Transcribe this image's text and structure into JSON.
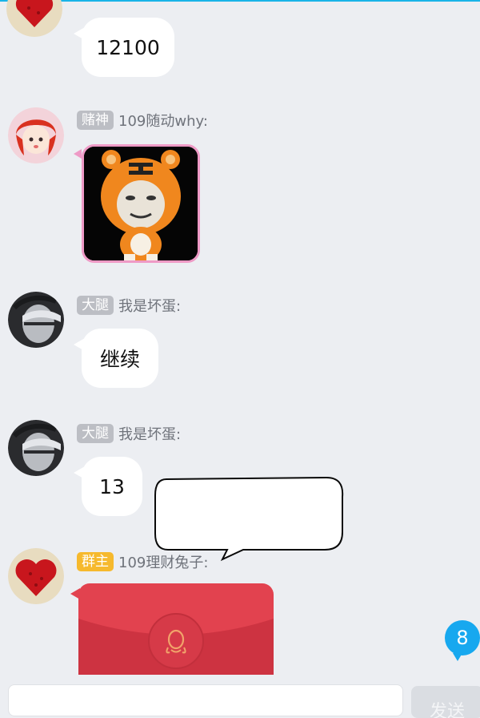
{
  "colors": {
    "background": "#eceef2",
    "bubble": "#ffffff",
    "badge_gray": "#bcbec4",
    "badge_gold": "#f6b92d",
    "red_packet": "#e2424f",
    "unread_badge": "#17a8ef"
  },
  "messages": [
    {
      "type": "text",
      "text": "12100",
      "avatar": "heart-roses-avatar"
    },
    {
      "type": "sticker",
      "badge": "赌神",
      "sender": "109随动why:",
      "avatar": "red-hair-girl-avatar",
      "sticker": "tiger-costume-face-sticker"
    },
    {
      "type": "text",
      "badge": "大腿",
      "sender": "我是坏蛋:",
      "text": "继续",
      "avatar": "face-hand-avatar"
    },
    {
      "type": "text",
      "badge": "大腿",
      "sender": "我是坏蛋:",
      "text": "13",
      "avatar": "face-hand-avatar"
    },
    {
      "type": "red-packet",
      "badge": "群主",
      "sender": "109理财兔子:",
      "avatar": "heart-roses-avatar",
      "icon": "penguin-icon"
    }
  ],
  "unread_count": "8",
  "composer": {
    "send_label": "发送"
  }
}
